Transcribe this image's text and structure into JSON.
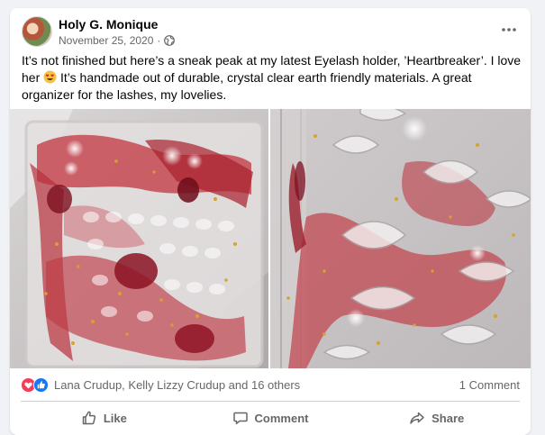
{
  "post": {
    "author": "Holy G. Monique",
    "date": "November 25, 2020",
    "separator": "·",
    "privacy_icon": "globe-icon",
    "more_icon": "more-options-icon",
    "text_part1": "It’s not finished but here’s a sneak peak at my latest Eyelash holder, ’Heartbreaker’. I love her",
    "text_emoji": "heart-eyes-emoji",
    "text_part2": " It’s handmade out of durable, crystal clear earth friendly materials. A great organizer for the lashes, my lovelies."
  },
  "reactions": {
    "icons": [
      "love-reaction-icon",
      "like-reaction-icon"
    ],
    "names": "Lana Crudup, Kelly Lizzy Crudup and 16 others",
    "comments": "1 Comment"
  },
  "actions": {
    "like": "Like",
    "comment": "Comment",
    "share": "Share"
  },
  "colors": {
    "accent_blue": "#1877f2",
    "love_red": "#f33e58",
    "secondary_text": "#65676b"
  }
}
